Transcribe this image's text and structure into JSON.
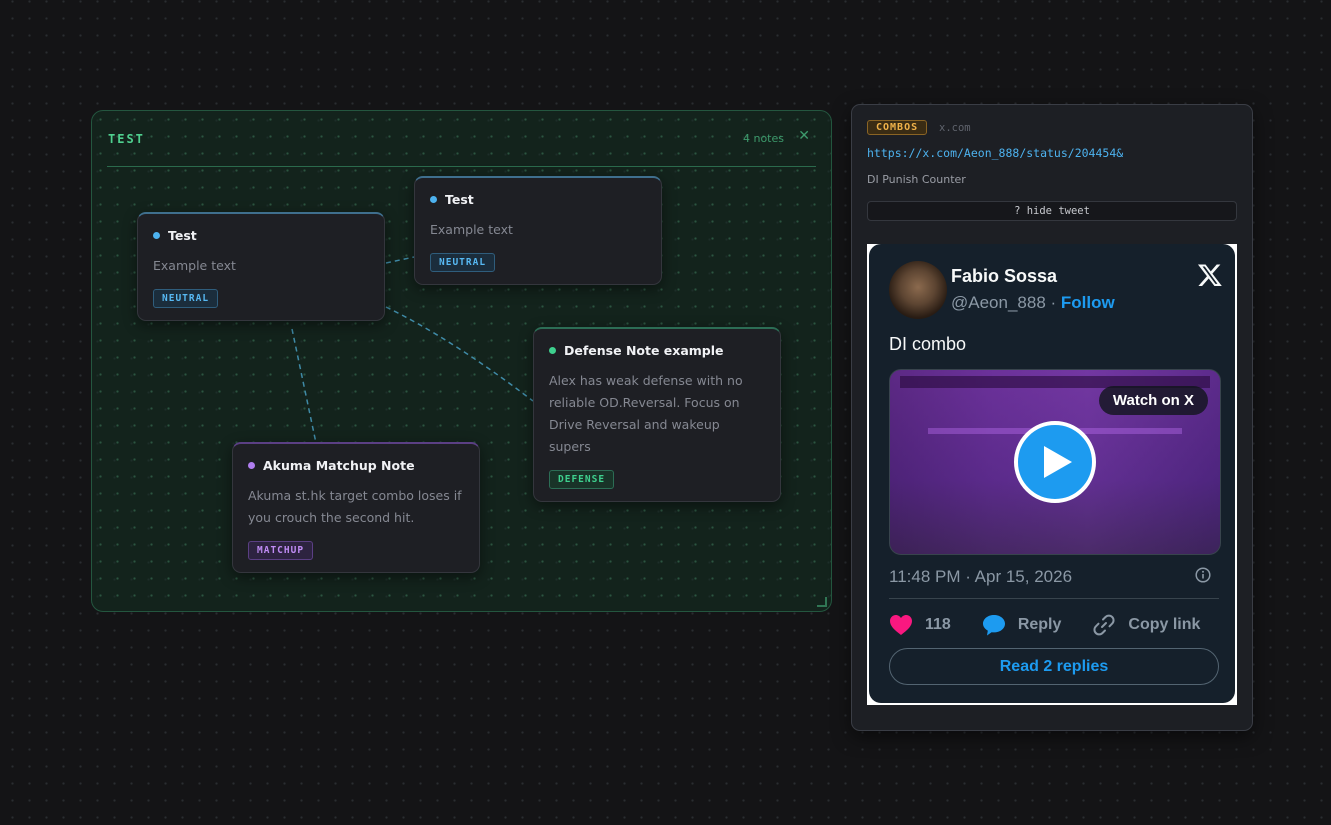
{
  "group": {
    "title": "TEST",
    "count_label": "4 notes",
    "close_glyph": "✕"
  },
  "notes": [
    {
      "title": "Test",
      "body": "Example text",
      "tag": "NEUTRAL",
      "color": "#4db2ef"
    },
    {
      "title": "Test",
      "body": "Example text",
      "tag": "NEUTRAL",
      "color": "#4db2ef"
    },
    {
      "title": "Defense Note example",
      "body": "Alex has weak defense with no reliable OD.Reversal. Focus on Drive Reversal and wakeup supers",
      "tag": "DEFENSE",
      "color": "#3ed08e"
    },
    {
      "title": "Akuma Matchup Note",
      "body": "Akuma st.hk target combo loses if you crouch the second hit.",
      "tag": "MATCHUP",
      "color": "#b07ef0"
    }
  ],
  "link_card": {
    "tag": "COMBOS",
    "tag_color": "#f0b24a",
    "domain": "x.com",
    "url": "https://x.com/Aeon_888/status/204454&",
    "description": "DI Punish Counter",
    "toggle_label": "? hide tweet"
  },
  "tweet": {
    "author_name": "Fabio Sossa",
    "handle": "@Aeon_888",
    "separator": " · ",
    "follow_label": "Follow",
    "text": "DI combo",
    "watch_label": "Watch on X",
    "timestamp": "11:48 PM · Apr 15, 2026",
    "like_count": "118",
    "reply_label": "Reply",
    "copy_link_label": "Copy link",
    "read_replies_label": "Read 2 replies",
    "icons": [
      "x-logo-icon",
      "play-icon",
      "info-icon",
      "heart-icon",
      "reply-bubble-icon",
      "link-icon"
    ],
    "colors": {
      "accent": "#1d9bf0",
      "like": "#f91880",
      "background": "#15202b"
    }
  }
}
